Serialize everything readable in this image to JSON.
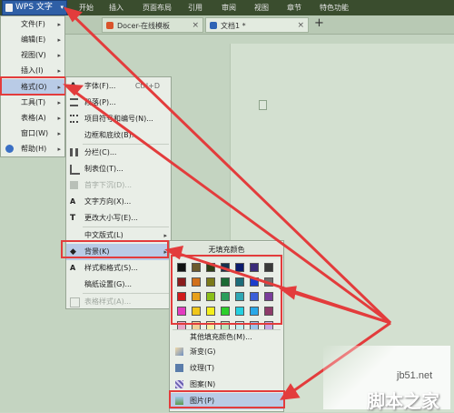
{
  "ribbon": {
    "app_button": "WPS 文字",
    "tabs": [
      "开始",
      "插入",
      "页面布局",
      "引用",
      "审阅",
      "视图",
      "章节",
      "特色功能"
    ]
  },
  "doc_tabs": {
    "template_tab": "Docer-在线模板",
    "document_tab": "文档1 *",
    "new_tab": "+"
  },
  "main_menu": {
    "items": [
      {
        "label": "文件(F)"
      },
      {
        "label": "编辑(E)"
      },
      {
        "label": "视图(V)"
      },
      {
        "label": "插入(I)"
      },
      {
        "label": "格式(O)"
      },
      {
        "label": "工具(T)"
      },
      {
        "label": "表格(A)"
      },
      {
        "label": "窗口(W)"
      },
      {
        "label": "帮助(H)"
      }
    ]
  },
  "format_menu": {
    "items": [
      {
        "label": "字体(F)...",
        "shortcut": "Ctrl+D"
      },
      {
        "label": "段落(P)..."
      },
      {
        "label": "项目符号和编号(N)..."
      },
      {
        "label": "边框和底纹(B)..."
      },
      {
        "label": "分栏(C)..."
      },
      {
        "label": "制表位(T)..."
      },
      {
        "label": "首字下沉(D)..."
      },
      {
        "label": "文字方向(X)..."
      },
      {
        "label": "更改大小写(E)..."
      },
      {
        "label": "中文版式(L)"
      },
      {
        "label": "背景(K)"
      },
      {
        "label": "样式和格式(S)..."
      },
      {
        "label": "稿纸设置(G)..."
      },
      {
        "label": "表格样式(A)..."
      }
    ]
  },
  "background_menu": {
    "no_fill": "无填充颜色",
    "more_colors": "其他填充颜色(M)...",
    "gradient": "渐变(G)",
    "texture": "纹理(T)",
    "pattern": "图案(N)",
    "picture": "图片(P)",
    "palette": [
      [
        "#111111",
        "#6b5a2e",
        "#2d3f17",
        "#16314d",
        "#0c1c6e",
        "#3b2c7a",
        "#3a3a3a"
      ],
      [
        "#8a1d1d",
        "#d1711c",
        "#7b7a1a",
        "#1b6a34",
        "#1d6c7a",
        "#1c3ecb",
        "#6f6f6f"
      ],
      [
        "#d11b1b",
        "#e8a11c",
        "#8ac01a",
        "#2a9d5a",
        "#2fa7b4",
        "#3b5ed8",
        "#7a3d9b"
      ],
      [
        "#e33cc0",
        "#f0c61a",
        "#f4ef1c",
        "#2ccf2c",
        "#25d0e0",
        "#2aa8e8",
        "#8e3b6a"
      ],
      [
        "#e9a6c9",
        "#eed19a",
        "#f4f0a6",
        "#bfe6bd",
        "#c6eef0",
        "#9ec3ea",
        "#c7a8e4"
      ]
    ]
  },
  "watermark": {
    "site": "jb51.net",
    "brand": "脚本之家"
  }
}
